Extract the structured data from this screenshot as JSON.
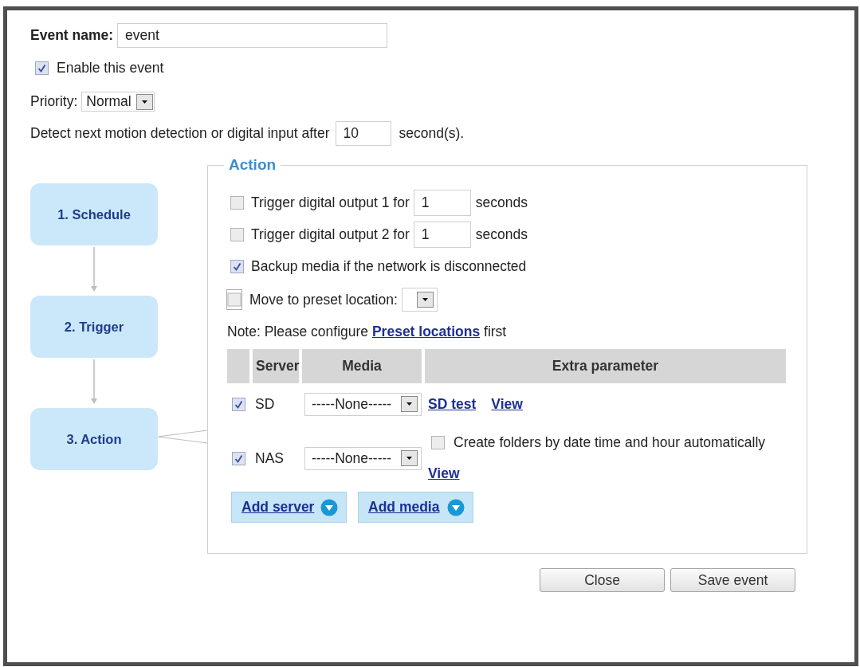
{
  "event_name": {
    "label": "Event name:",
    "value": "event"
  },
  "enable": {
    "label": "Enable this event",
    "checked": true
  },
  "priority": {
    "label": "Priority:",
    "value": "Normal"
  },
  "detect": {
    "label": "Detect next motion detection or digital input after",
    "value": "10",
    "unit": "second(s)."
  },
  "steps": [
    "1. Schedule",
    "2. Trigger",
    "3. Action"
  ],
  "action": {
    "legend": "Action",
    "options": [
      {
        "kind": "duration",
        "label": "Trigger digital output 1 for",
        "checked": false,
        "focused": false,
        "value": "1",
        "unit": "seconds"
      },
      {
        "kind": "duration",
        "label": "Trigger digital output 2 for",
        "checked": false,
        "focused": false,
        "value": "1",
        "unit": "seconds"
      },
      {
        "kind": "plain",
        "label": "Backup media if the network is disconnected",
        "checked": true,
        "focused": false
      },
      {
        "kind": "select",
        "label": "Move to preset location:",
        "checked": false,
        "focused": true
      }
    ],
    "note": {
      "text": "Note: Please configure",
      "link": "Preset locations",
      "after": "first"
    },
    "table": {
      "columns": [
        "Server",
        "Media",
        "Extra parameter"
      ],
      "rows": [
        {
          "checked": true,
          "server": "SD",
          "media": "-----None-----",
          "extra": [
            {
              "kind": "link",
              "text": "SD test"
            },
            {
              "kind": "link",
              "text": "View"
            }
          ]
        },
        {
          "checked": true,
          "server": "NAS",
          "media": "-----None-----",
          "extra": [
            {
              "kind": "checkbox",
              "label": "Create folders by date time and hour automatically",
              "checked": false
            },
            {
              "kind": "link",
              "text": "View"
            }
          ]
        }
      ]
    },
    "add_buttons": [
      "Add server",
      "Add media"
    ]
  },
  "buttons": [
    "Close",
    "Save event"
  ]
}
